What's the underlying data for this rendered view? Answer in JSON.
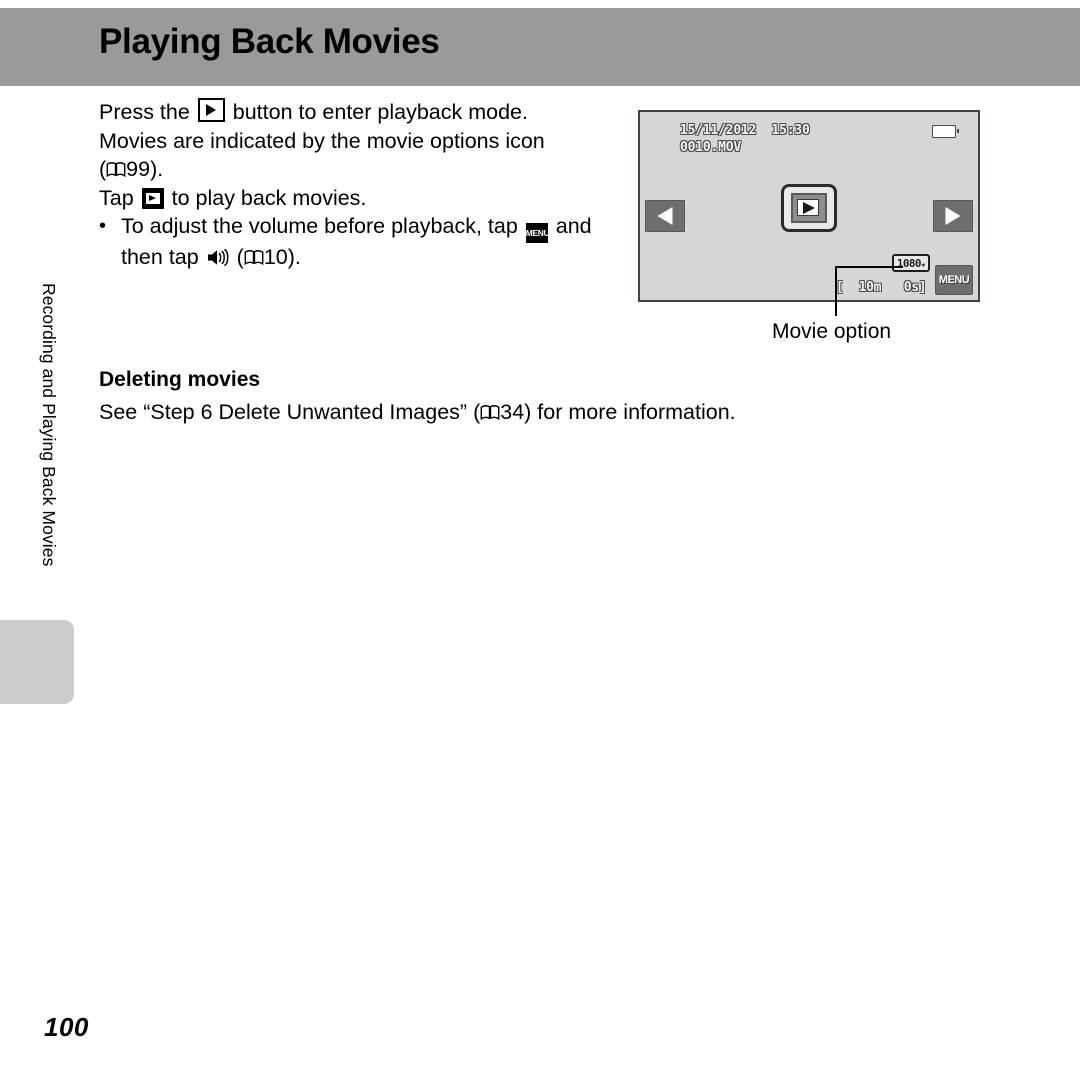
{
  "page": {
    "title": "Playing Back Movies",
    "number": "100",
    "side_tab_label": "Recording and Playing Back Movies"
  },
  "body": {
    "line1_prefix": "Press the ",
    "line1_icon": "playback-button-icon",
    "line1_suffix": " button to enter playback mode.",
    "line2": "Movies are indicated by the movie options icon",
    "line3_open": "(",
    "line3_icon": "book-reference-icon",
    "line3_ref": "99).",
    "line4_prefix": "Tap ",
    "line4_icon": "play-icon",
    "line4_suffix": " to play back movies.",
    "bullet_dot": "•",
    "bullet_line1_prefix": "To adjust the volume before playback, tap ",
    "bullet_line1_icon": "menu-icon",
    "bullet_line1_suffix": " and",
    "bullet_line2_prefix": "then tap ",
    "bullet_line2_icon": "speaker-icon",
    "bullet_line2_open": " (",
    "bullet_line2_book": "book-reference-icon",
    "bullet_line2_ref": "10)."
  },
  "section": {
    "heading": "Deleting movies",
    "paragraph_part1": "See “Step 6 Delete Unwanted Images” (",
    "paragraph_book_icon": "book-reference-icon",
    "paragraph_part2": "34) for more information."
  },
  "camera": {
    "osd_datetime": "15/11/2012  15:30",
    "osd_filename": "0010.MOV",
    "battery_icon": "battery-icon",
    "prev_icon": "triangle-left-icon",
    "next_icon": "triangle-right-icon",
    "play_icon": "play-icon",
    "movie_option_badge": "1080",
    "movie_option_badge_suffix": "★",
    "menu_label": "MENU",
    "time_counter": "[  10m   0s]"
  },
  "callout": {
    "label": "Movie option"
  },
  "colors": {
    "header_band": "#9a9a9a",
    "side_tab": "#cccccc",
    "camera_screen": "#d6d6d6",
    "camera_border": "#4a3f3f",
    "camera_button": "#6e6e6e",
    "text": "#000000",
    "page_bg": "#ffffff"
  }
}
